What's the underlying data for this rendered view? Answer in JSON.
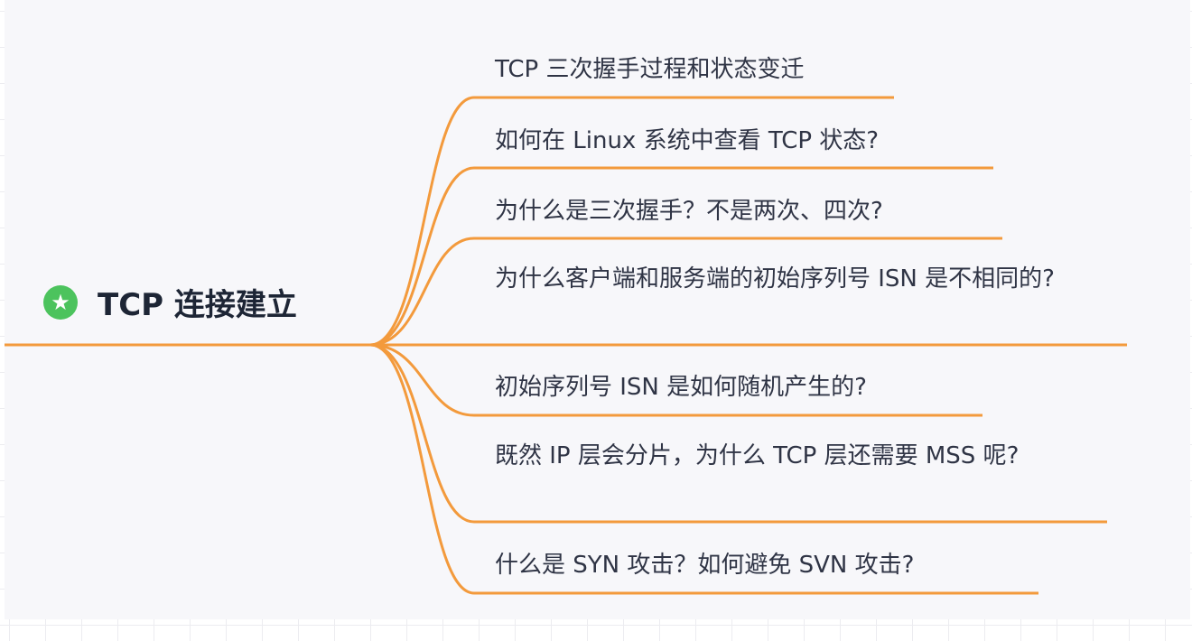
{
  "root": {
    "label": "TCP 连接建立",
    "icon": "star-icon",
    "color": "#4cc35d"
  },
  "branch_color": "#f39a3c",
  "children": [
    {
      "label": "TCP 三次握手过程和状态变迁"
    },
    {
      "label": "如何在 Linux 系统中查看 TCP 状态?"
    },
    {
      "label": "为什么是三次握手？不是两次、四次?"
    },
    {
      "label": "为什么客户端和服务端的初始序列号 ISN 是不相同的?"
    },
    {
      "label": "初始序列号 ISN 是如何随机产生的?"
    },
    {
      "label": "既然 IP 层会分片，为什么 TCP 层还需要 MSS 呢?"
    },
    {
      "label": "什么是 SYN 攻击？如何避免 SVN 攻击?"
    }
  ]
}
